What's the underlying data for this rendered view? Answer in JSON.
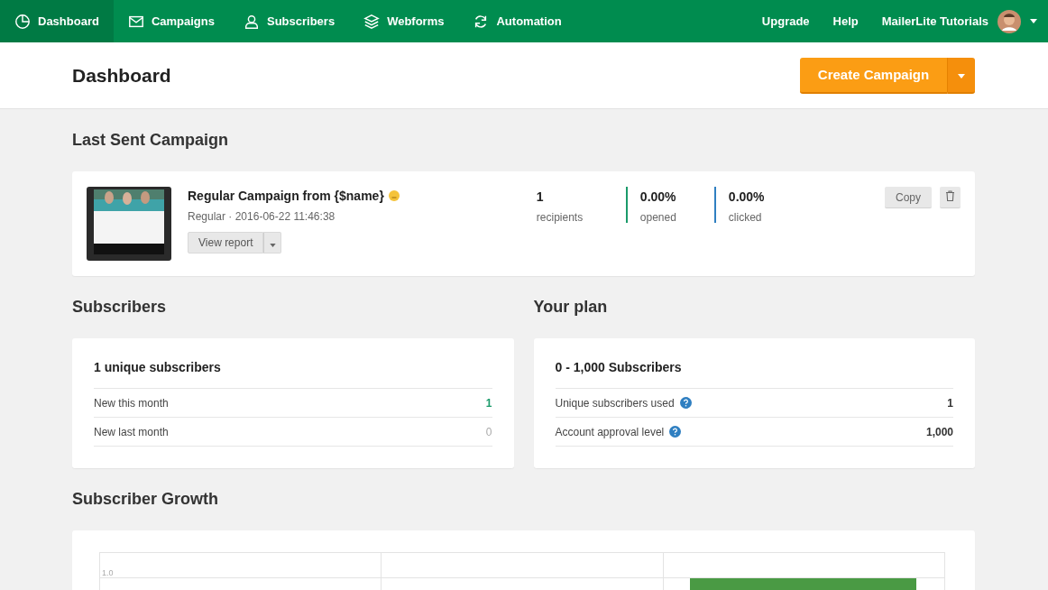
{
  "nav": {
    "items": [
      {
        "label": "Dashboard",
        "kind": "overview",
        "selected": true
      },
      {
        "label": "Campaigns",
        "kind": "campaigns",
        "selected": false
      },
      {
        "label": "Subscribers",
        "kind": "subscribers",
        "selected": false
      },
      {
        "label": "Webforms",
        "kind": "forms",
        "selected": false
      },
      {
        "label": "Automation",
        "kind": "automation",
        "selected": false
      }
    ],
    "right": [
      "Upgrade",
      "Help"
    ],
    "account": "MailerLite Tutorials"
  },
  "header": {
    "title": "Dashboard",
    "button": "Create Campaign"
  },
  "last_sent": {
    "title": "Last Sent Campaign",
    "name": "Regular Campaign from {$name}",
    "meta": "Regular · 2016-06-22 11:46:38",
    "report_button": "View report",
    "stats": [
      {
        "value": "1",
        "label": "recipients"
      },
      {
        "value": "0.00%",
        "label": "opened",
        "color": "#1a9a6a"
      },
      {
        "value": "0.00%",
        "label": "clicked",
        "color": "#2f7fc1"
      }
    ],
    "copy_button": "Copy"
  },
  "subscribers": {
    "title": "Subscribers",
    "heading": "1 unique subscribers",
    "rows": [
      {
        "label": "New this month",
        "value": "1",
        "highlight": true
      },
      {
        "label": "New last month",
        "value": "0",
        "highlight": false
      }
    ]
  },
  "plan": {
    "title": "Your plan",
    "heading": "0 - 1,000 Subscribers",
    "rows": [
      {
        "label": "Unique subscribers used",
        "value": "1",
        "help": true
      },
      {
        "label": "Account approval level",
        "value": "1,000",
        "help": true
      }
    ]
  },
  "growth": {
    "title": "Subscriber Growth",
    "tick_label": "1.0"
  }
}
